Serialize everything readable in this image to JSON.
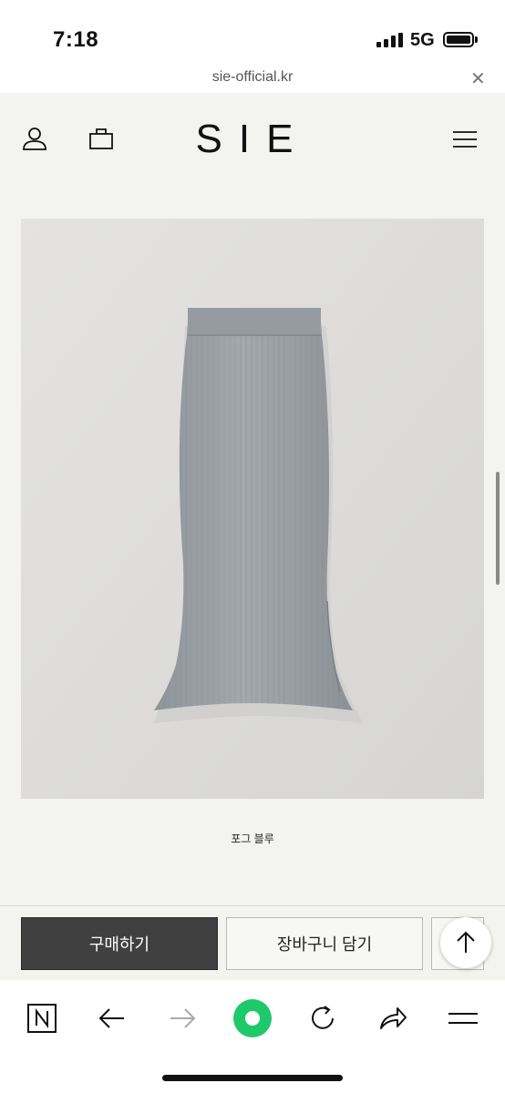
{
  "status_bar": {
    "time": "7:18",
    "network": "5G"
  },
  "url_bar": {
    "domain": "sie-official.kr",
    "close_symbol": "✕"
  },
  "header": {
    "logo": "SIE",
    "icons": [
      "user-icon",
      "bag-icon",
      "menu-icon"
    ]
  },
  "product": {
    "color_label": "포그 블루",
    "image": "gray-blue-ribbed-knit-mermaid-skirt"
  },
  "actions": {
    "buy_label": "구매하기",
    "cart_label": "장바구니 담기"
  },
  "browser_toolbar": {
    "icons": [
      "naver-n-icon",
      "back-arrow-icon",
      "forward-arrow-icon",
      "green-circle-icon",
      "refresh-icon",
      "share-icon",
      "menu-lines-icon"
    ]
  },
  "colors": {
    "page_bg": "#f3f3ef",
    "buy_button": "#404040",
    "accent_green": "#1ec96c",
    "skirt": "#9aa0a4"
  }
}
